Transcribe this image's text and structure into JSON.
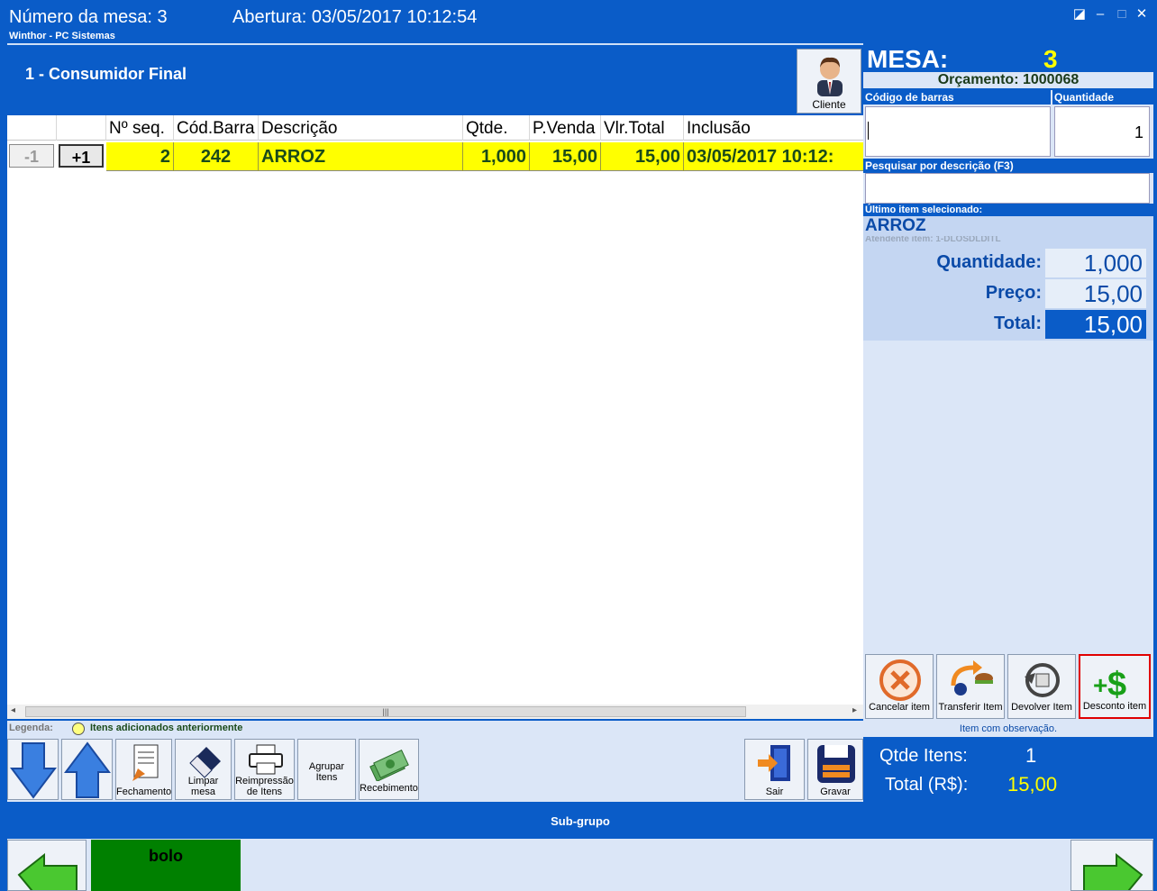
{
  "title": {
    "mesa": "Número da mesa: 3",
    "abertura": "Abertura: 03/05/2017 10:12:54",
    "app": "Winthor - PC Sistemas"
  },
  "customer": {
    "name": "1 - Consumidor Final",
    "button_label": "Cliente"
  },
  "grid": {
    "headers": {
      "seq": "Nº seq.",
      "barcode": "Cód.Barra",
      "desc": "Descrição",
      "qty": "Qtde.",
      "price": "P.Venda",
      "total": "Vlr.Total",
      "date": "Inclusão"
    },
    "rows": [
      {
        "minus": "-1",
        "plus": "+1",
        "seq": "2",
        "barcode": "242",
        "desc": "ARROZ",
        "qty": "1,000",
        "price": "15,00",
        "total": "15,00",
        "date": "03/05/2017 10:12:"
      }
    ],
    "row_color": "#ffff00"
  },
  "legend": {
    "label": "Legenda:",
    "text": "Itens adicionados anteriormente"
  },
  "toolbar": {
    "fechamento": "Fechamento",
    "limpar": "Limpar mesa",
    "reimpressao1": "Reimpressão",
    "reimpressao2": "de Itens",
    "agrupar1": "Agrupar",
    "agrupar2": "Itens",
    "recebimento": "Recebimento",
    "sair": "Sair",
    "gravar": "Gravar"
  },
  "right": {
    "mesa_label": "MESA:",
    "mesa_number": "3",
    "orcamento": "Orçamento: 1000068",
    "barcode_label": "Código de barras",
    "qty_label": "Quantidade",
    "qty_value": "1",
    "search_label": "Pesquisar por descrição (F3)",
    "last_label": "Último item selecionado:",
    "last_item": "ARROZ",
    "attendant": "Atendente item: 1-DLOSDLDITL",
    "detail_qty_label": "Quantidade:",
    "detail_qty": "1,000",
    "detail_price_label": "Preço:",
    "detail_price": "15,00",
    "detail_total_label": "Total:",
    "detail_total": "15,00",
    "btn_cancelar": "Cancelar item",
    "btn_transferir": "Transferir Item",
    "btn_devolver": "Devolver Item",
    "btn_desconto": "Desconto item",
    "obs": "Item com observação.",
    "qtde_label": "Qtde Itens:",
    "qtde_value": "1",
    "total_label": "Total (R$):",
    "total_value": "15,00"
  },
  "bottom": {
    "subgrupo": "Sub-grupo",
    "group_item": "bolo"
  }
}
